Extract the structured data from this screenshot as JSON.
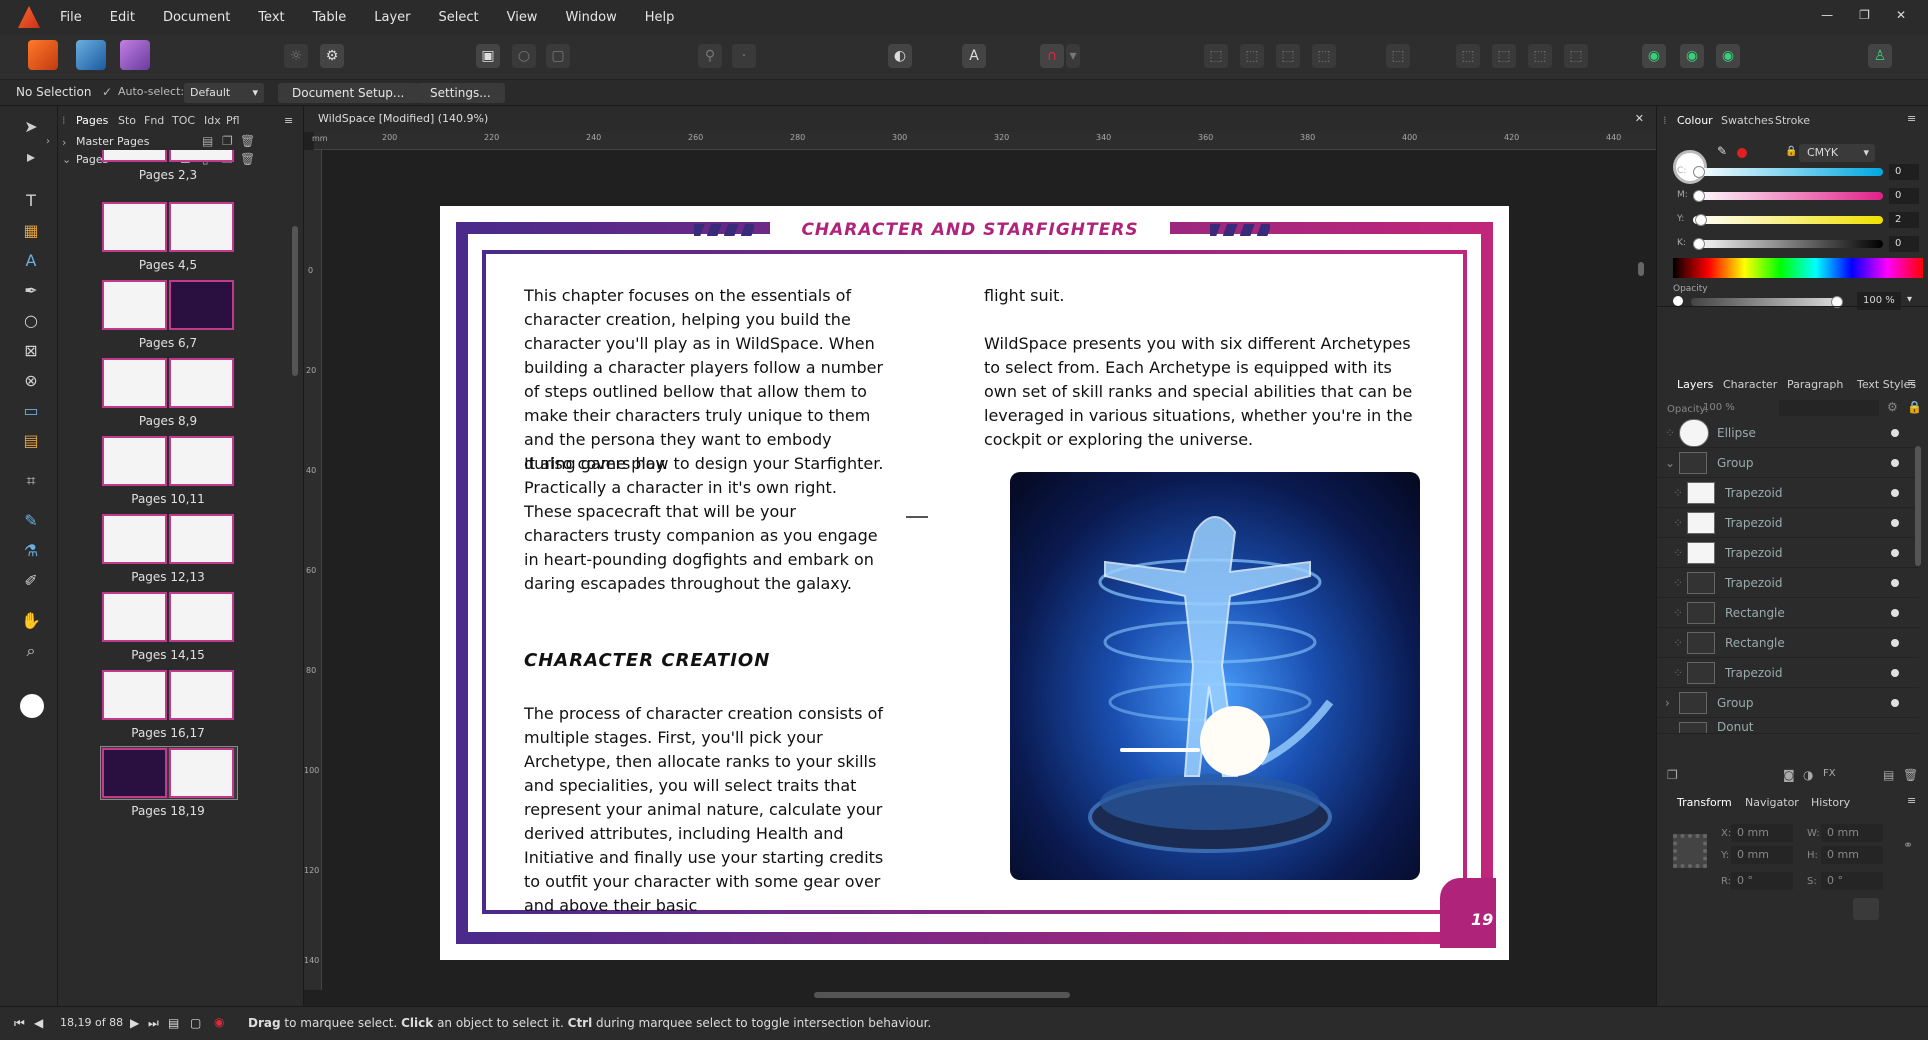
{
  "menubar": {
    "items": [
      "File",
      "Edit",
      "Document",
      "Text",
      "Table",
      "Layer",
      "Select",
      "View",
      "Window",
      "Help"
    ],
    "window_controls": [
      "—",
      "❐",
      "✕"
    ]
  },
  "context": {
    "selection": "No Selection",
    "auto_select_label": "Auto-select:",
    "auto_select_value": "Default",
    "document_setup": "Document Setup...",
    "settings": "Settings..."
  },
  "pages_panel": {
    "tabs": [
      "Pages",
      "Sto",
      "Fnd",
      "TOC",
      "Idx",
      "Pfl"
    ],
    "master_pages": "Master Pages",
    "pages": "Pages",
    "thumbs": [
      "Pages 2,3",
      "Pages 4,5",
      "Pages 6,7",
      "Pages 8,9",
      "Pages 10,11",
      "Pages 12,13",
      "Pages 14,15",
      "Pages 16,17",
      "Pages 18,19"
    ]
  },
  "document": {
    "tab_title": "WildSpace [Modified] (140.9%)",
    "ruler_unit": "mm",
    "ruler_h": [
      "200",
      "220",
      "240",
      "260",
      "280",
      "300",
      "320",
      "340",
      "360",
      "380",
      "400",
      "420",
      "440"
    ],
    "ruler_v": [
      "0",
      "20",
      "40",
      "60",
      "80",
      "100",
      "120",
      "140"
    ],
    "header": "CHARACTER AND STARFIGHTERS",
    "col1_p1": "This chapter focuses on the essentials of character creation, helping you build the character you'll play as in WildSpace. When building a character players follow a number of steps outlined bellow that allow them to make their characters truly unique to them and the persona they want to embody during game play.",
    "col1_p2": "It also covers how to design your Starfighter. Practically a character in it's own right. These spacecraft that will be your characters trusty companion as you engage in heart-pounding dogfights and embark on daring escapades throughout the galaxy.",
    "section_heading": "CHARACTER CREATION",
    "col1_p3": "The process of character creation consists of multiple stages. First, you'll pick your Archetype, then allocate ranks to your skills and specialities, you will select traits that represent your animal nature, calculate your derived attributes, including Health and Initiative and finally use your starting credits to outfit your character with some gear over and above their basic",
    "col2_p1": "flight suit.",
    "col2_p2": "WildSpace presents you with six different Archetypes to select from. Each Archetype is equipped with its own set of skill ranks and special abilities that can be leveraged in various situations, whether you're in the cockpit or exploring the universe.",
    "page_number": "19"
  },
  "colour_panel": {
    "tabs": [
      "Colour",
      "Swatches",
      "Stroke"
    ],
    "model": "CMYK",
    "channels": [
      {
        "label": "C:",
        "value": "0"
      },
      {
        "label": "M:",
        "value": "0"
      },
      {
        "label": "Y:",
        "value": "2"
      },
      {
        "label": "K:",
        "value": "0"
      }
    ],
    "opacity_label": "Opacity",
    "opacity_value": "100 %"
  },
  "layers_panel": {
    "tabs": [
      "Layers",
      "Character",
      "Paragraph",
      "Text Styles"
    ],
    "opacity_label": "Opacity:",
    "opacity_value": "100 %",
    "layers": [
      "Ellipse",
      "Group",
      "Trapezoid",
      "Trapezoid",
      "Trapezoid",
      "Trapezoid",
      "Rectangle",
      "Rectangle",
      "Trapezoid",
      "Group",
      "Donut"
    ]
  },
  "transform_panel": {
    "tabs": [
      "Transform",
      "Navigator",
      "History"
    ],
    "x_label": "X:",
    "x_value": "0 mm",
    "y_label": "Y:",
    "y_value": "0 mm",
    "w_label": "W:",
    "w_value": "0 mm",
    "h_label": "H:",
    "h_value": "0 mm",
    "r_label": "R:",
    "r_value": "0 °",
    "s_label": "S:",
    "s_value": "0 °"
  },
  "status": {
    "page_indicator": "18,19 of 88",
    "hint_drag": "Drag",
    "hint_1": " to marquee select. ",
    "hint_click": "Click",
    "hint_2": " an object to select it. ",
    "hint_ctrl": "Ctrl",
    "hint_3": " during marquee select to toggle intersection behaviour."
  }
}
